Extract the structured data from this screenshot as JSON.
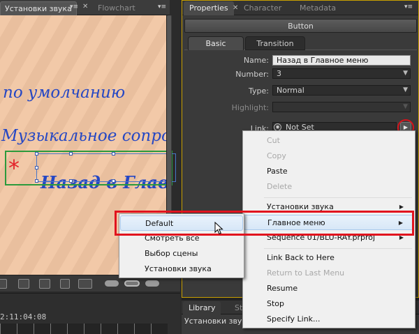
{
  "left_panel": {
    "tabs": [
      {
        "label": "Установки звука",
        "active": true
      },
      {
        "label": "Flowchart",
        "active": false
      }
    ],
    "canvas_texts": {
      "line1": "по умолчанию",
      "line2": "Музыкальное сопровождение",
      "line3": "Назад в Главное меню",
      "star": "*"
    },
    "timecode": "00;00;11;04;08",
    "timecode_visible": "2:11:04:08"
  },
  "right_panel": {
    "tabs": [
      {
        "label": "Properties",
        "active": true
      },
      {
        "label": "Character",
        "active": false
      },
      {
        "label": "Metadata",
        "active": false
      }
    ],
    "header": "Button",
    "subtabs": [
      {
        "label": "Basic",
        "active": true
      },
      {
        "label": "Transition",
        "active": false
      }
    ],
    "fields": {
      "name_label": "Name:",
      "name_value": "Назад в Главное меню",
      "number_label": "Number:",
      "number_value": "3",
      "type_label": "Type:",
      "type_value": "Normal",
      "highlight_label": "Highlight:",
      "highlight_value": "",
      "link_label": "Link:",
      "link_value": "Not Set",
      "override_label": "Ov"
    },
    "bottom_tabs": [
      {
        "label": "Library"
      },
      {
        "label": "St"
      }
    ],
    "bottom_path": "Установки звука"
  },
  "context_menu": {
    "items": [
      {
        "label": "Cut",
        "enabled": false
      },
      {
        "label": "Copy",
        "enabled": false
      },
      {
        "label": "Paste",
        "enabled": true
      },
      {
        "label": "Delete",
        "enabled": false
      },
      {
        "label": "Установки звука",
        "enabled": true,
        "submenu": true
      },
      {
        "label": "Главное меню",
        "enabled": true,
        "submenu": true,
        "highlighted": true
      },
      {
        "label": "Sequence 01/BLU-RAY.prproj",
        "enabled": true,
        "submenu": true
      },
      {
        "label": "Link Back to Here",
        "enabled": true
      },
      {
        "label": "Return to Last Menu",
        "enabled": false
      },
      {
        "label": "Resume",
        "enabled": true
      },
      {
        "label": "Stop",
        "enabled": true
      },
      {
        "label": "Specify Link...",
        "enabled": true
      }
    ]
  },
  "submenu": {
    "items": [
      {
        "label": "Default",
        "highlighted": true
      },
      {
        "label": "Смотреть всё"
      },
      {
        "label": "Выбор сцены"
      },
      {
        "label": "Установки звука"
      }
    ]
  },
  "colors": {
    "highlight_annotation": "#e1131e",
    "panel_focus_border": "#c9a000",
    "handwriting": "#2547c4",
    "selection_green": "#2b9a3c"
  }
}
